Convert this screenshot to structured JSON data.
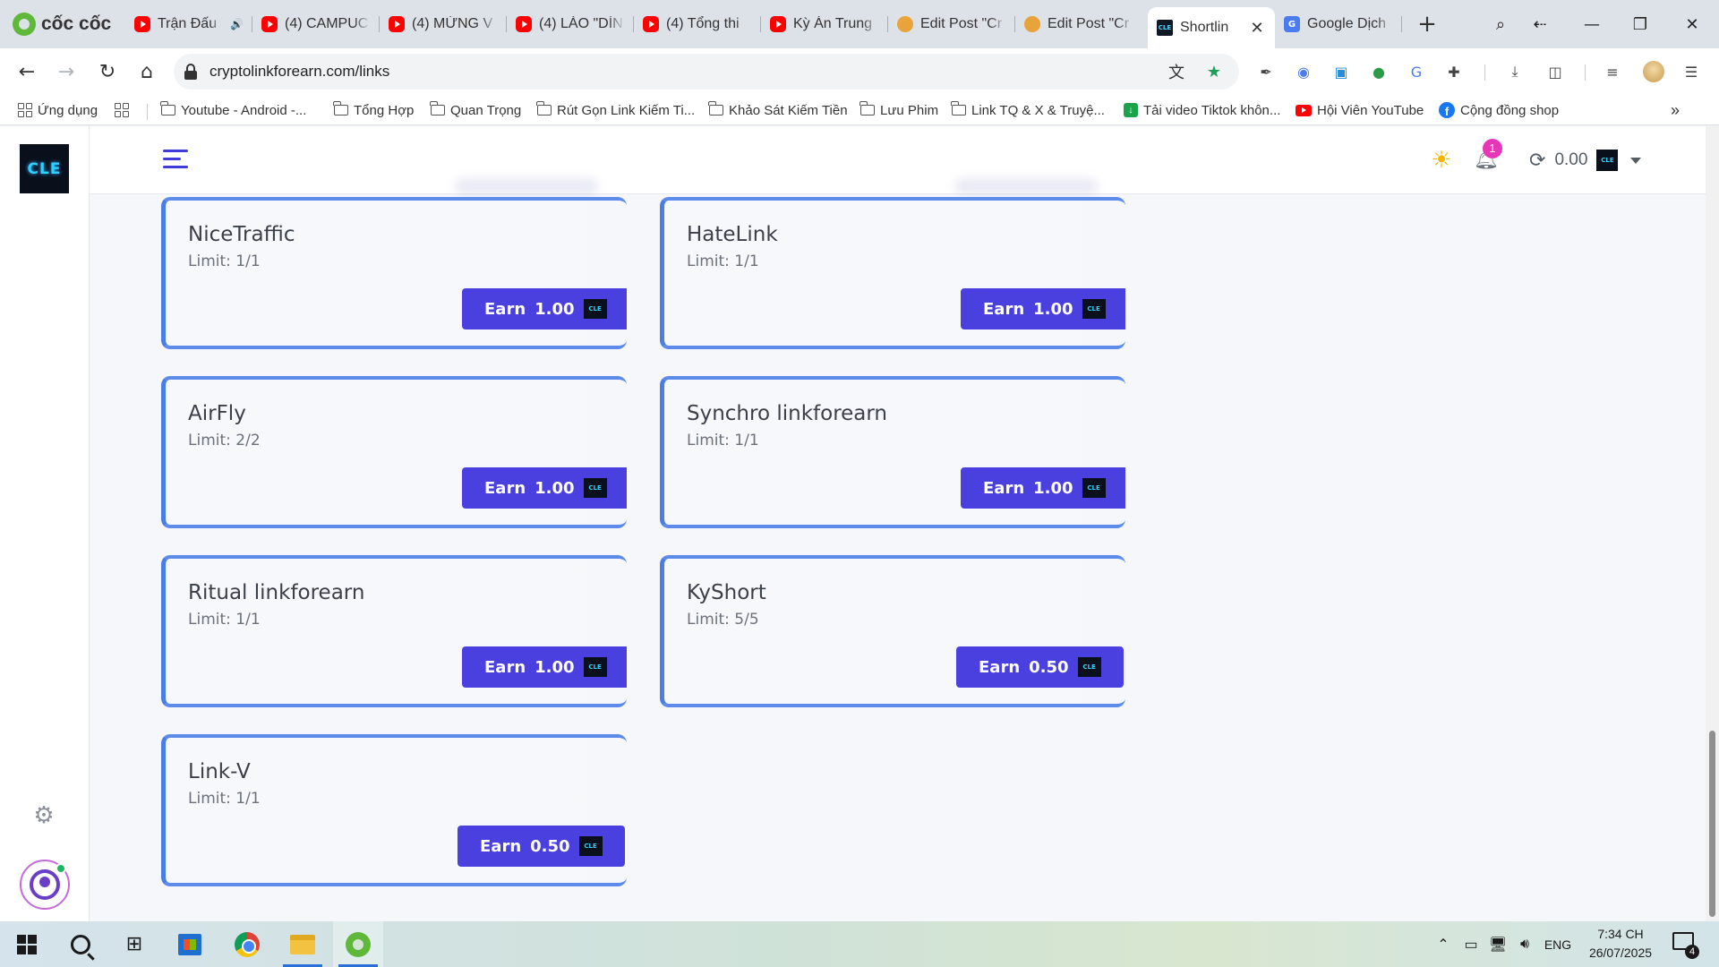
{
  "browser": {
    "brand": "cốc cốc",
    "tabs": [
      {
        "label": "Trận Đấu",
        "icon": "youtube-icon",
        "audio": true
      },
      {
        "label": "(4) CAMPUC",
        "icon": "youtube-icon"
      },
      {
        "label": "(4) MỪNG V",
        "icon": "youtube-icon"
      },
      {
        "label": "(4) LÀO \"DÍN",
        "icon": "youtube-icon"
      },
      {
        "label": "(4) Tổng thi",
        "icon": "youtube-icon"
      },
      {
        "label": "Kỳ Án Trung",
        "icon": "youtube-icon"
      },
      {
        "label": "Edit Post \"Cr",
        "icon": "edit-post-icon"
      },
      {
        "label": "Edit Post \"Cr",
        "icon": "edit-post-icon"
      },
      {
        "label": "Shortlin",
        "icon": "cle-icon",
        "active": true
      },
      {
        "label": "Google Dịch",
        "icon": "google-translate-icon"
      }
    ],
    "url": "cryptolinkforearn.com/links",
    "bookmarks": [
      {
        "label": "Ứng dụng",
        "icon": "apps-icon"
      },
      {
        "label": "Youtube - Android -...",
        "icon": "folder-icon"
      },
      {
        "label": "Tổng Hợp",
        "icon": "folder-icon"
      },
      {
        "label": "Quan Trọng",
        "icon": "folder-icon"
      },
      {
        "label": "Rút Gọn Link Kiếm Ti...",
        "icon": "folder-icon"
      },
      {
        "label": "Khảo Sát Kiếm Tiền",
        "icon": "folder-icon"
      },
      {
        "label": "Lưu Phim",
        "icon": "folder-icon"
      },
      {
        "label": "Link TQ & X & Truyệ...",
        "icon": "folder-icon"
      },
      {
        "label": "Tải video Tiktok khôn...",
        "icon": "download-icon"
      },
      {
        "label": "Hội Viên YouTube",
        "icon": "youtube-icon"
      },
      {
        "label": "Cộng đồng shop",
        "icon": "facebook-icon"
      }
    ]
  },
  "site": {
    "logo_text": "CLE",
    "notification_count": "1",
    "balance": "0.00",
    "coin_text": "CLE"
  },
  "cards": [
    {
      "title": "NiceTraffic",
      "limit": "Limit: 1/1",
      "earn_label": "Earn",
      "amount": "1.00"
    },
    {
      "title": "HateLink",
      "limit": "Limit: 1/1",
      "earn_label": "Earn",
      "amount": "1.00"
    },
    {
      "title": "AirFly",
      "limit": "Limit: 2/2",
      "earn_label": "Earn",
      "amount": "1.00"
    },
    {
      "title": "Synchro linkforearn",
      "limit": "Limit: 1/1",
      "earn_label": "Earn",
      "amount": "1.00"
    },
    {
      "title": "Ritual linkforearn",
      "limit": "Limit: 1/1",
      "earn_label": "Earn",
      "amount": "1.00"
    },
    {
      "title": "KyShort",
      "limit": "Limit: 5/5",
      "earn_label": "Earn",
      "amount": "0.50"
    },
    {
      "title": "Link-V",
      "limit": "Limit: 1/1",
      "earn_label": "Earn",
      "amount": "0.50"
    }
  ],
  "taskbar": {
    "language": "ENG",
    "time": "7:34 CH",
    "date": "26/07/2025",
    "notification_count": "4"
  },
  "colors": {
    "accent": "#4a40e0",
    "card_border": "#4a7ee6",
    "badge": "#e637b9"
  }
}
